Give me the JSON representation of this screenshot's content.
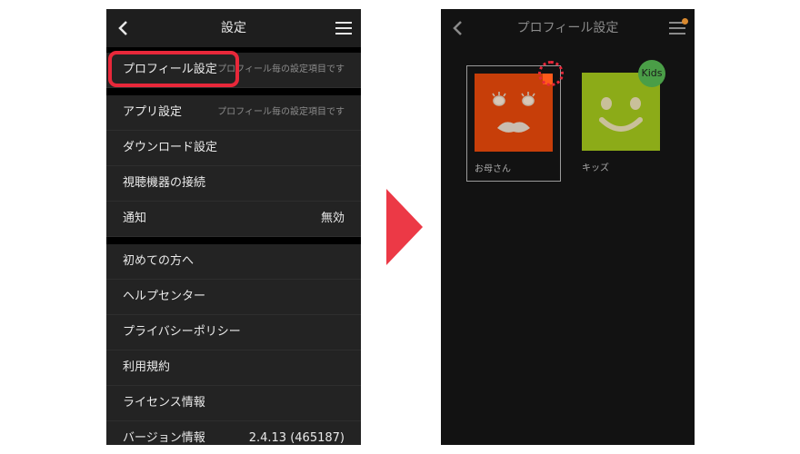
{
  "settings_screen": {
    "title": "設定",
    "profile_row": {
      "label": "プロフィール設定",
      "hint": "プロフィール毎の設定項目です"
    },
    "app_row": {
      "label": "アプリ設定",
      "hint": "プロフィール毎の設定項目です"
    },
    "download_row": {
      "label": "ダウンロード設定"
    },
    "devices_row": {
      "label": "視聴機器の接続"
    },
    "notification_row": {
      "label": "通知",
      "value": "無効"
    },
    "first_row": {
      "label": "初めての方へ"
    },
    "help_row": {
      "label": "ヘルプセンター"
    },
    "privacy_row": {
      "label": "プライバシーポリシー"
    },
    "terms_row": {
      "label": "利用規約"
    },
    "license_row": {
      "label": "ライセンス情報"
    },
    "version_row": {
      "label": "バージョン情報",
      "value": "2.4.13 (465187)"
    }
  },
  "profile_screen": {
    "title": "プロフィール設定",
    "profiles": [
      {
        "name": "お母さん",
        "color": "#c73e09",
        "selected": true
      },
      {
        "name": "キッズ",
        "color": "#8cab18",
        "badge": "Kids"
      }
    ]
  },
  "colors": {
    "highlight": "#e8283a",
    "arrow": "#ec3946",
    "menu_dot": "#d9892f"
  }
}
